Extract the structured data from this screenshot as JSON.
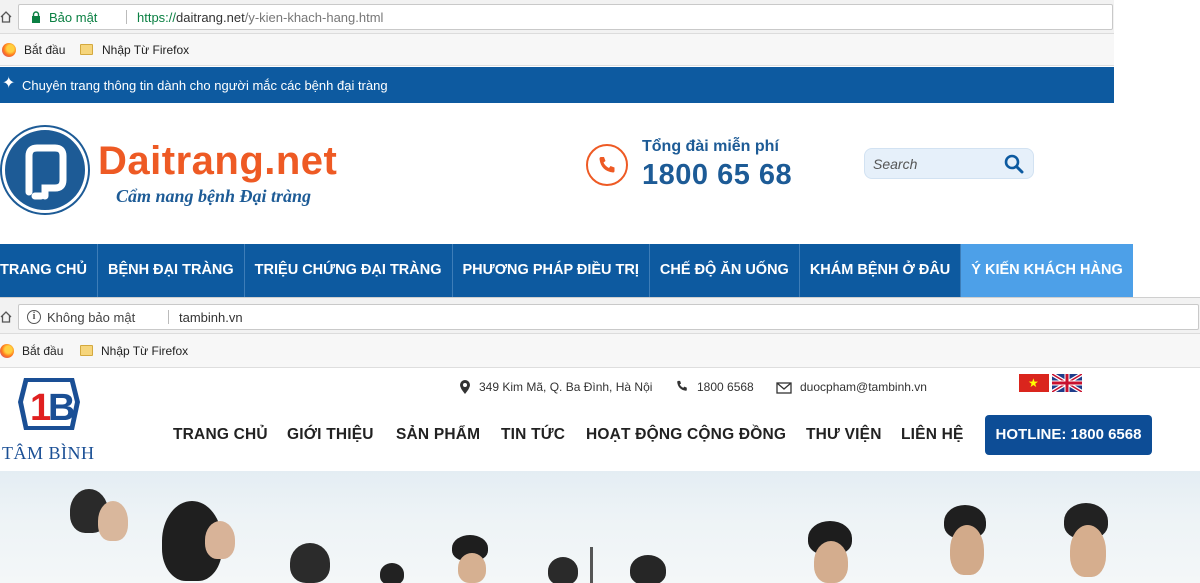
{
  "window1": {
    "address_bar": {
      "security_label": "Bảo mật",
      "url_scheme": "https://",
      "url_host": "daitrang.net",
      "url_path": "/y-kien-khach-hang.html"
    },
    "bookmarks": [
      {
        "label": "Bắt đầu",
        "icon": "firefox-icon"
      },
      {
        "label": "Nhập Từ Firefox",
        "icon": "folder-icon"
      }
    ],
    "site": {
      "tagline": "Chuyên trang thông tin dành cho người mắc các bệnh đại tràng",
      "brand": "Daitrang.net",
      "slogan": "Cẩm nang bệnh Đại tràng",
      "hotline_label": "Tổng đài miễn phí",
      "hotline_number": "1800 65 68",
      "search_placeholder": "Search",
      "nav": [
        {
          "label": "TRANG CHỦ"
        },
        {
          "label": "BỆNH ĐẠI TRÀNG"
        },
        {
          "label": "TRIỆU CHỨNG ĐẠI TRÀNG"
        },
        {
          "label": "PHƯƠNG PHÁP ĐIỀU TRỊ"
        },
        {
          "label": "CHẾ ĐỘ ĂN UỐNG"
        },
        {
          "label": "KHÁM BỆNH Ở ĐÂU"
        },
        {
          "label": "Ý KIẾN KHÁCH HÀNG",
          "active": true
        }
      ],
      "colors": {
        "primary": "#0d5aa0",
        "accent": "#ee5a24",
        "active_tab": "#4da0e8"
      }
    }
  },
  "window2": {
    "address_bar": {
      "security_label": "Không bảo mật",
      "url": "tambinh.vn"
    },
    "bookmarks": [
      {
        "label": "Bắt đầu",
        "icon": "firefox-icon"
      },
      {
        "label": "Nhập Từ Firefox",
        "icon": "folder-icon"
      }
    ],
    "site": {
      "logo_text": "TÂM BÌNH",
      "address": "349 Kim Mã, Q. Ba Đình, Hà Nội",
      "phone": "1800 6568",
      "email": "duocpham@tambinh.vn",
      "nav": [
        {
          "label": "TRANG CHỦ"
        },
        {
          "label": "GIỚI THIỆU"
        },
        {
          "label": "SẢN PHẨM"
        },
        {
          "label": "TIN TỨC"
        },
        {
          "label": "HOẠT ĐỘNG CỘNG ĐỒNG"
        },
        {
          "label": "THƯ VIỆN"
        },
        {
          "label": "LIÊN HỆ"
        }
      ],
      "hotline_button": "HOTLINE: 1800 6568",
      "languages": [
        "vietnamese-flag-icon",
        "english-flag-icon"
      ],
      "colors": {
        "primary": "#0d4d96",
        "logo_red": "#e02020"
      }
    }
  }
}
